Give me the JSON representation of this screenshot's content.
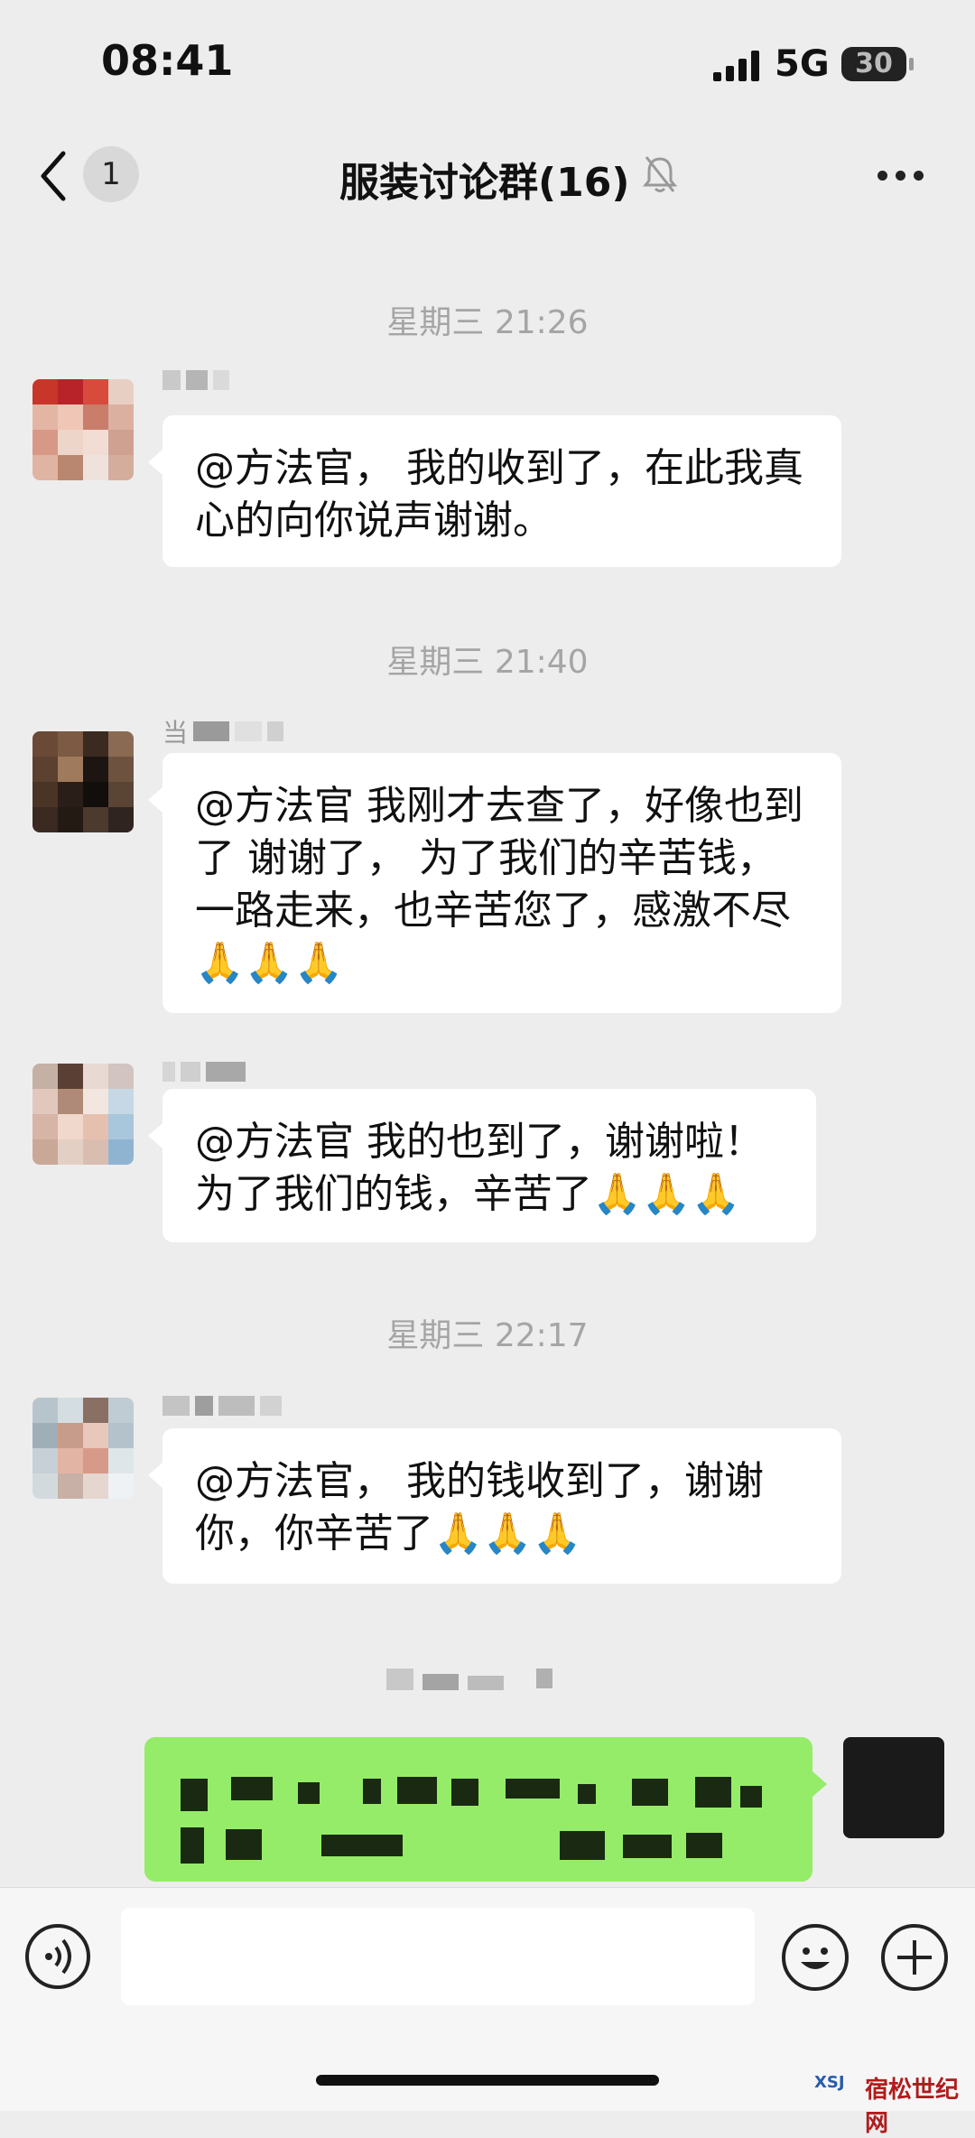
{
  "status_bar": {
    "time": "08:41",
    "network": "5G",
    "battery": "30"
  },
  "nav": {
    "unread_count": "1",
    "title": "服装讨论群(16)"
  },
  "messages": [
    {
      "timestamp": "星期三 21:26",
      "text": "@方法官， 我的收到了，在此我真心的向你说声谢谢。"
    },
    {
      "timestamp": "星期三 21:40",
      "sender_visible": "当",
      "text": "@方法官 我刚才去查了，好像也到了 谢谢了， 为了我们的辛苦钱，一路走来，也辛苦您了，感激不尽",
      "emoji": "🙏🙏🙏"
    },
    {
      "text": "@方法官 我的也到了，谢谢啦！为了我们的钱，辛苦了",
      "emoji": "🙏🙏🙏"
    },
    {
      "timestamp": "星期三 22:17",
      "text": "@方法官， 我的钱收到了，谢谢你，你辛苦了",
      "emoji": "🙏🙏🙏"
    }
  ],
  "input": {
    "placeholder": ""
  },
  "watermark": {
    "logo": "XSJ",
    "text": "宿松世纪网"
  },
  "colors": {
    "background": "#ededed",
    "bubble_other": "#ffffff",
    "bubble_own": "#95ec69"
  }
}
